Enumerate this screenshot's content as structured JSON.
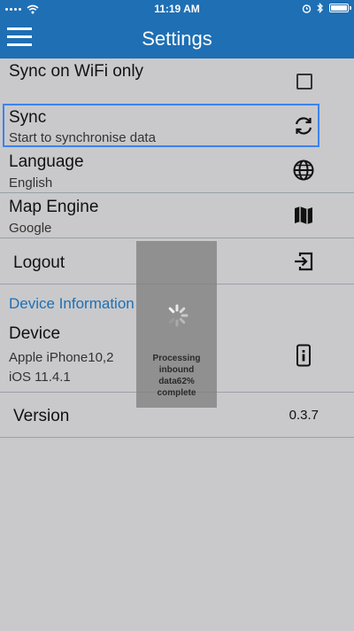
{
  "status_bar": {
    "time": "11:19 AM"
  },
  "nav": {
    "title": "Settings",
    "menu_icon": "hamburger-menu-icon"
  },
  "rows": {
    "sync_wifi": {
      "title": "Sync on WiFi only",
      "checked": false
    },
    "sync": {
      "title": "Sync",
      "subtitle": "Start to synchronise data",
      "icon": "sync-icon"
    },
    "language": {
      "title": "Language",
      "value": "English",
      "icon": "globe-icon"
    },
    "map_engine": {
      "title": "Map Engine",
      "value": "Google",
      "icon": "map-icon"
    },
    "logout": {
      "title": "Logout",
      "icon": "logout-icon"
    }
  },
  "device_section": {
    "header": "Device Information",
    "device": {
      "title": "Device",
      "model": "Apple iPhone10,2",
      "os": "iOS 11.4.1",
      "icon": "phone-info-icon"
    },
    "version": {
      "title": "Version",
      "value": "0.3.7"
    }
  },
  "overlay": {
    "text": "Processing\ninbound\ndata62%\ncomplete",
    "progress_percent": 62
  },
  "colors": {
    "accent": "#1f6fb4",
    "focus": "#3d82f0",
    "background": "#c9c9cb"
  }
}
